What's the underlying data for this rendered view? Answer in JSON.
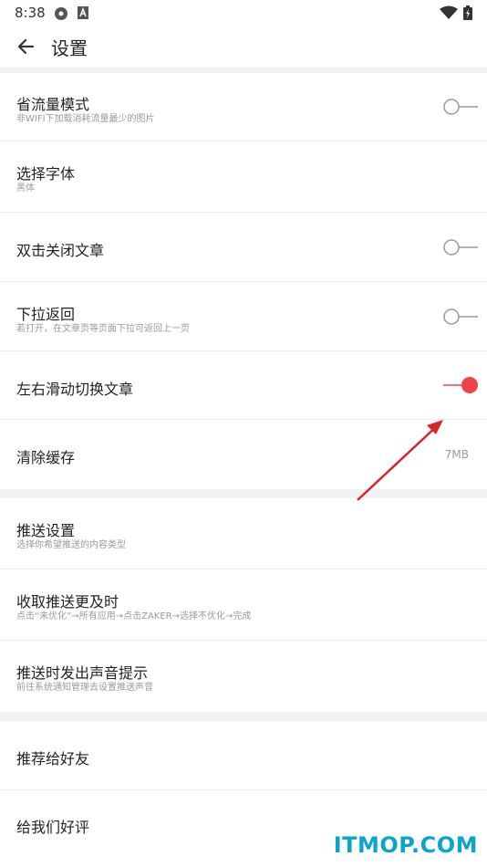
{
  "status_bar": {
    "time": "8:38"
  },
  "app_bar": {
    "title": "设置"
  },
  "colors": {
    "accent": "#f0424a",
    "divider": "#ececec",
    "watermark": "#0aa6c8"
  },
  "section1": [
    {
      "title": "省流量模式",
      "subtitle": "非WIFI下加载消耗流量最少的图片",
      "control": "toggle",
      "on": false
    },
    {
      "title": "选择字体",
      "subtitle": "黑体",
      "control": "none"
    },
    {
      "title": "双击关闭文章",
      "subtitle": "",
      "control": "toggle",
      "on": false
    },
    {
      "title": "下拉返回",
      "subtitle": "若打开，在文章页等页面下拉可返回上一页",
      "control": "toggle",
      "on": false
    },
    {
      "title": "左右滑动切换文章",
      "subtitle": "",
      "control": "toggle",
      "on": true
    },
    {
      "title": "清除缓存",
      "subtitle": "",
      "control": "value",
      "value": "7MB"
    }
  ],
  "section2": [
    {
      "title": "推送设置",
      "subtitle": "选择你希望推送的内容类型"
    },
    {
      "title": "收取推送更及时",
      "subtitle": "点击“未优化”→所有应用→点击ZAKER→选择不优化→完成"
    },
    {
      "title": "推送时发出声音提示",
      "subtitle": "前往系统通知管理去设置推送声音"
    }
  ],
  "section3": [
    {
      "title": "推荐给好友"
    },
    {
      "title": "给我们好评"
    }
  ],
  "watermark": "ITMOP.COM"
}
